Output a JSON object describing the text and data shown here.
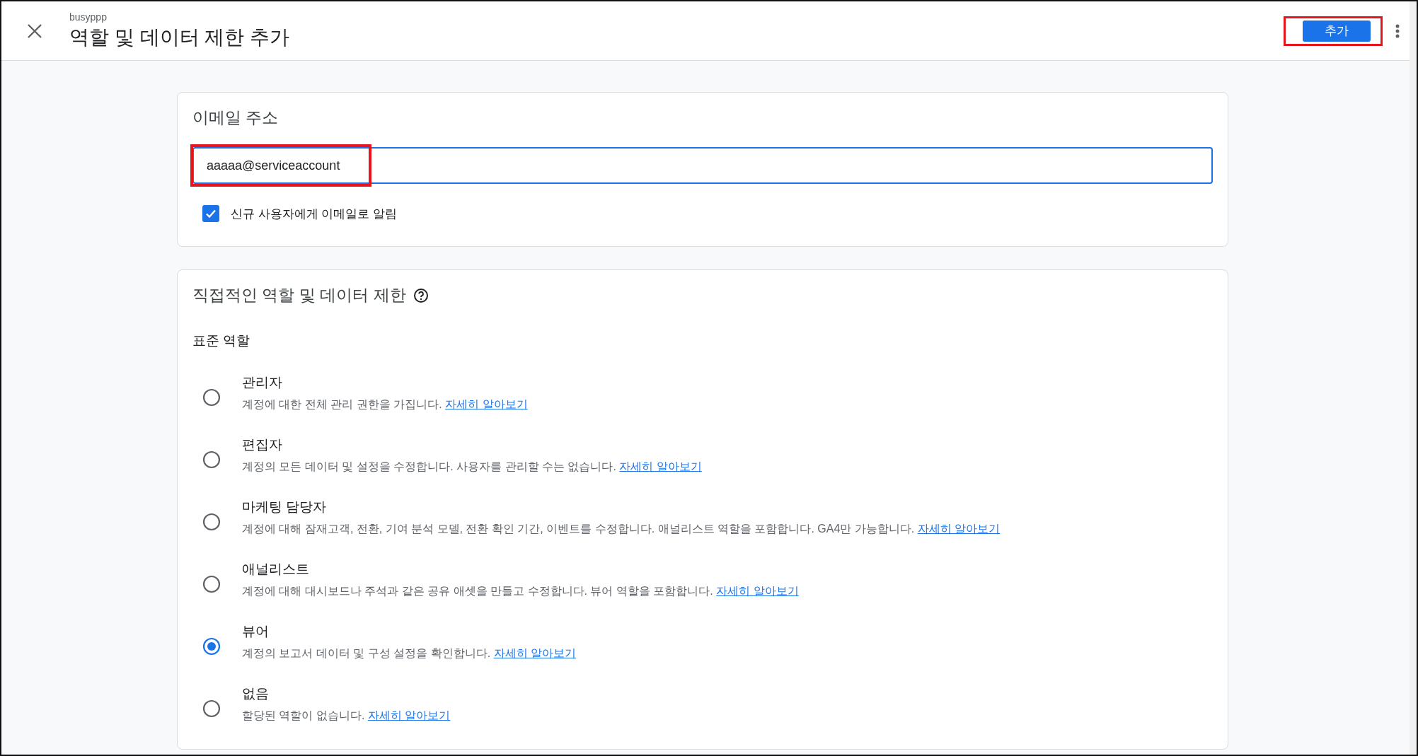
{
  "header": {
    "account": "busyppp",
    "title": "역할 및 데이터 제한 추가",
    "add_button": {
      "label": "추가",
      "highlighted": true
    }
  },
  "email_card": {
    "title": "이메일 주소",
    "email": {
      "value": "aaaaa@serviceaccount",
      "highlighted": true
    },
    "notify": {
      "label": "신규 사용자에게 이메일로 알림",
      "checked": true
    }
  },
  "roles_card": {
    "title": "직접적인 역할 및 데이터 제한",
    "subtitle": "표준 역할",
    "roles": [
      {
        "name": "관리자",
        "description": "계정에 대한 전체 관리 권한을 가집니다.",
        "link": "자세히 알아보기",
        "selected": false
      },
      {
        "name": "편집자",
        "description": "계정의 모든 데이터 및 설정을 수정합니다. 사용자를 관리할 수는 없습니다.",
        "link": "자세히 알아보기",
        "selected": false
      },
      {
        "name": "마케팅 담당자",
        "description": "계정에 대해 잠재고객, 전환, 기여 분석 모델, 전환 확인 기간, 이벤트를 수정합니다. 애널리스트 역할을 포함합니다. GA4만 가능합니다.",
        "link": "자세히 알아보기",
        "selected": false
      },
      {
        "name": "애널리스트",
        "description": "계정에 대해 대시보드나 주석과 같은 공유 애셋을 만들고 수정합니다. 뷰어 역할을 포함합니다.",
        "link": "자세히 알아보기",
        "selected": false
      },
      {
        "name": "뷰어",
        "description": "계정의 보고서 데이터 및 구성 설정을 확인합니다.",
        "link": "자세히 알아보기",
        "selected": true
      },
      {
        "name": "없음",
        "description": "할당된 역할이 없습니다.",
        "link": "자세히 알아보기",
        "selected": false
      }
    ]
  }
}
